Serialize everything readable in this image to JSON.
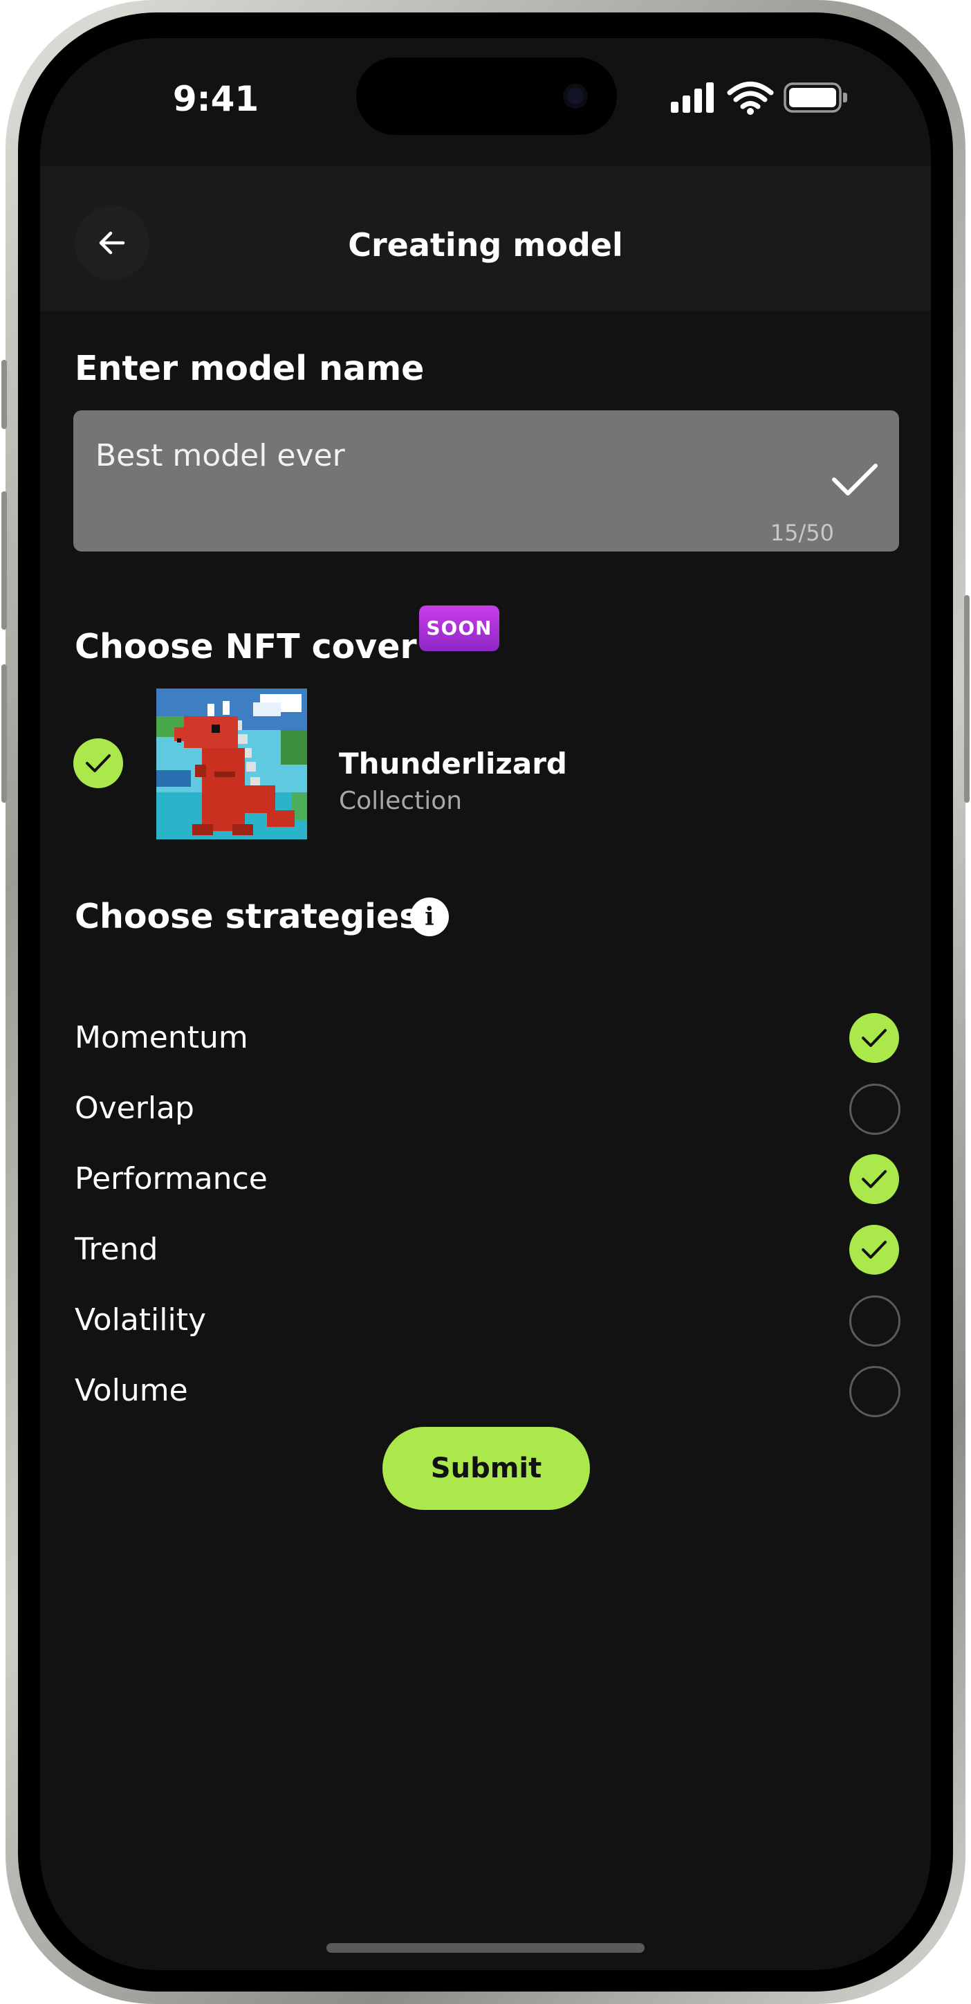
{
  "status_bar": {
    "time": "9:41"
  },
  "header": {
    "title": "Creating model",
    "back_icon": "arrow-left-icon"
  },
  "model_name": {
    "section_title": "Enter model name",
    "value": "Best model ever",
    "counter": "15/50",
    "confirm_icon": "check-icon"
  },
  "nft_cover": {
    "section_title": "Choose NFT cover",
    "badge": "SOON",
    "item": {
      "name": "Thunderlizard",
      "subtitle": "Collection",
      "selected": true
    }
  },
  "strategies": {
    "section_title": "Choose strategies",
    "info_icon": "info-icon",
    "items": [
      {
        "label": "Momentum",
        "selected": true
      },
      {
        "label": "Overlap",
        "selected": false
      },
      {
        "label": "Performance",
        "selected": true
      },
      {
        "label": "Trend",
        "selected": true
      },
      {
        "label": "Volatility",
        "selected": false
      },
      {
        "label": "Volume",
        "selected": false
      }
    ]
  },
  "submit_label": "Submit",
  "colors": {
    "accent": "#abe84b",
    "background": "#121212",
    "header_bg": "#1a1a1a",
    "badge": "#b233d9",
    "input_bg": "#757575"
  }
}
